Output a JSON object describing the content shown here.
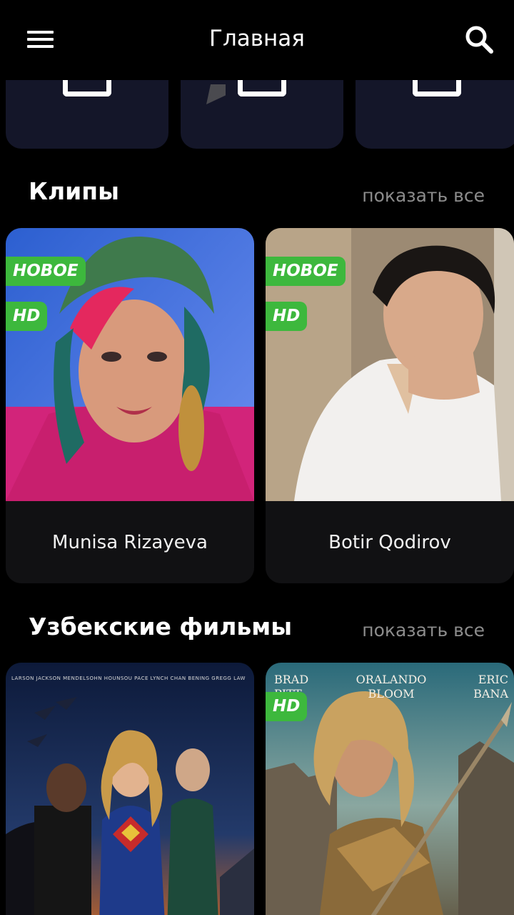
{
  "app_bar": {
    "title": "Главная",
    "menu_icon": "hamburger-menu-icon",
    "search_icon": "search-icon"
  },
  "top_row": {
    "cards": [
      {
        "icon": "tv-icon"
      },
      {
        "icon": "tv-icon"
      },
      {
        "icon": "tv-icon"
      }
    ]
  },
  "clips": {
    "title": "Клипы",
    "show_all": "показать все",
    "items": [
      {
        "caption": "Munisa Rizayeva",
        "badges": [
          "НОВОЕ",
          "HD"
        ]
      },
      {
        "caption": "Botir Qodirov",
        "badges": [
          "НОВОЕ",
          "HD"
        ]
      }
    ]
  },
  "films": {
    "title": "Узбекские фильмы",
    "show_all": "показать все",
    "items": [
      {
        "poster_credits": "LARSON  JACKSON  MENDELSOHN  HOUNSOU  PACE  LYNCH  CHAN  BENING  GREGG  LAW",
        "badges": []
      },
      {
        "poster_credits": [
          "BRAD PITT",
          "ORALANDO BLOOM",
          "ERIC BANA"
        ],
        "badges": [
          "HD"
        ]
      }
    ]
  },
  "colors": {
    "background": "#000000",
    "badge_green": "#3DB83D",
    "card_dark": "#141629",
    "caption_bg": "#111113",
    "muted_text": "#8C8C8C"
  }
}
